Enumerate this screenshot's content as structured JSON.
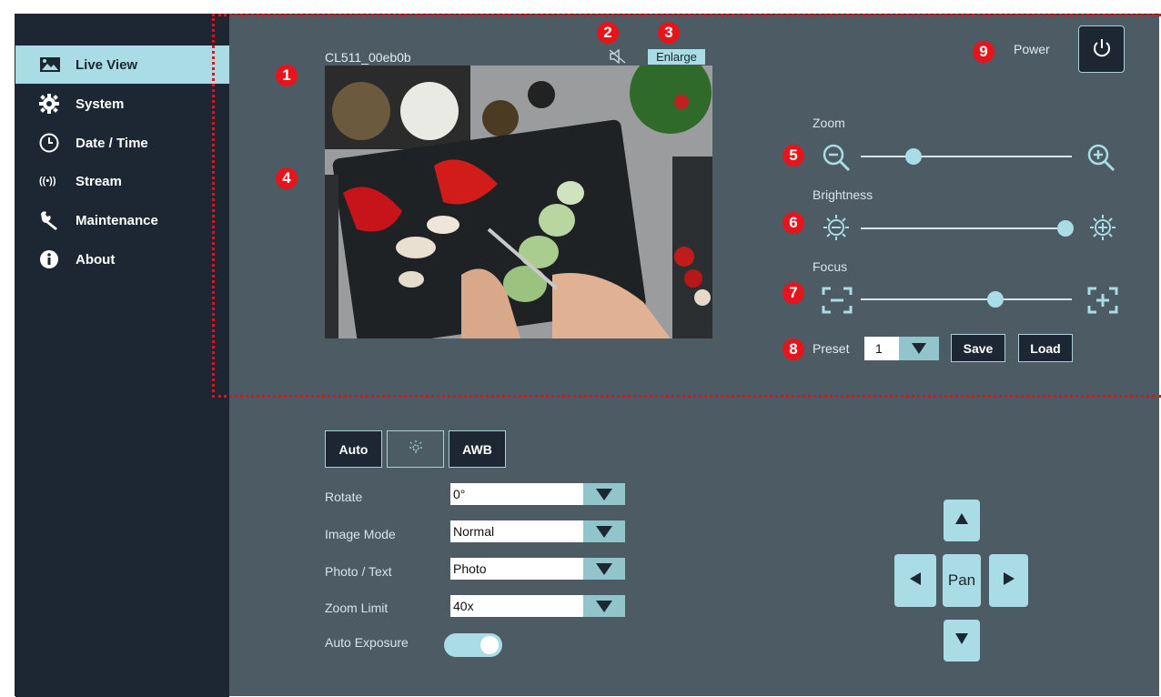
{
  "sidebar": {
    "items": [
      {
        "label": "Live View",
        "icon": "image-icon",
        "active": true
      },
      {
        "label": "System",
        "icon": "gear-icon"
      },
      {
        "label": "Date / Time",
        "icon": "clock-icon"
      },
      {
        "label": "Stream",
        "icon": "broadcast-icon"
      },
      {
        "label": "Maintenance",
        "icon": "wrench-icon"
      },
      {
        "label": "About",
        "icon": "info-icon"
      }
    ]
  },
  "camera": {
    "name": "CL511_00eb0b",
    "enlarge_label": "Enlarge",
    "mute_icon": "speaker-muted-icon"
  },
  "markers": [
    "1",
    "2",
    "3",
    "4",
    "5",
    "6",
    "7",
    "8",
    "9"
  ],
  "power": {
    "label": "Power",
    "icon": "power-icon"
  },
  "zoom": {
    "label": "Zoom",
    "level": 0.25
  },
  "brightness": {
    "label": "Brightness",
    "level": 0.97
  },
  "focus": {
    "label": "Focus",
    "level": 0.64
  },
  "preset": {
    "label": "Preset",
    "value": "1",
    "save_label": "Save",
    "load_label": "Load"
  },
  "image_tabs": {
    "auto_label": "Auto",
    "awb_label": "AWB",
    "light_icon": "lightbulb-icon"
  },
  "settings": {
    "rotate": {
      "label": "Rotate",
      "value": "0°"
    },
    "image_mode": {
      "label": "Image Mode",
      "value": "Normal"
    },
    "photo_text": {
      "label": "Photo / Text",
      "value": "Photo"
    },
    "zoom_limit": {
      "label": "Zoom Limit",
      "value": "40x"
    },
    "auto_exposure": {
      "label": "Auto Exposure",
      "on": true
    }
  },
  "pan": {
    "label": "Pan"
  },
  "colors": {
    "sidebar_bg": "#1d2733",
    "main_bg": "#4d5b65",
    "accent": "#a9dce4",
    "marker": "#e8141c"
  }
}
